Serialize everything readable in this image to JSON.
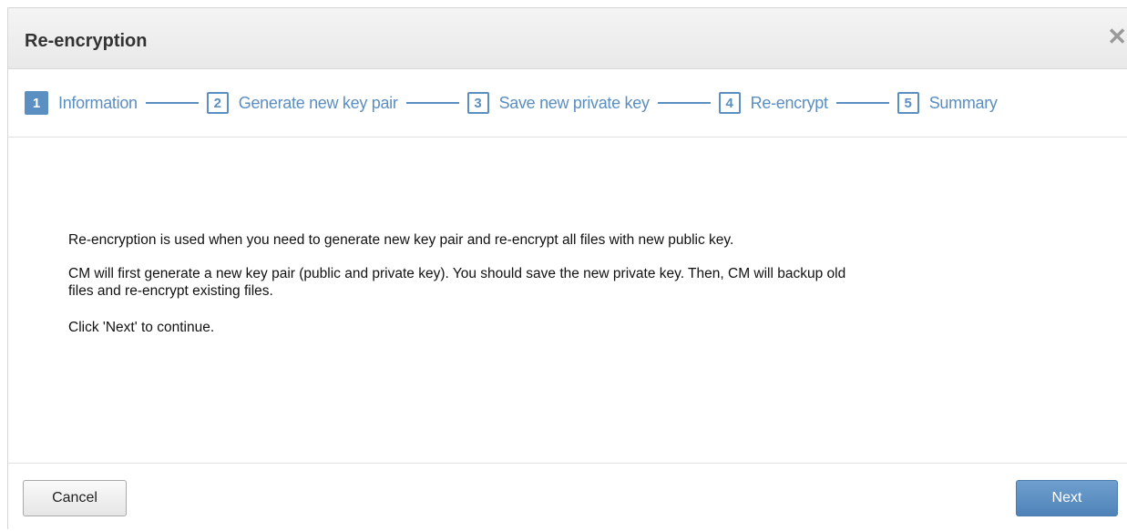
{
  "dialog": {
    "title": "Re-encryption",
    "close_symbol": "✕"
  },
  "steps": [
    {
      "number": "1",
      "label": "Information",
      "active": true
    },
    {
      "number": "2",
      "label": "Generate new key pair",
      "active": false
    },
    {
      "number": "3",
      "label": "Save new private key",
      "active": false
    },
    {
      "number": "4",
      "label": "Re-encrypt",
      "active": false
    },
    {
      "number": "5",
      "label": "Summary",
      "active": false
    }
  ],
  "content": {
    "paragraph1": "Re-encryption is used when you need to generate new key pair and re-encrypt all files with new public key.",
    "paragraph2_line1": "CM will first generate a new key pair (public and private key). You should save the new private key. Then, CM will backup old",
    "paragraph2_line2": "files and re-encrypt existing files.",
    "paragraph3": "Click 'Next' to continue."
  },
  "footer": {
    "cancel_label": "Cancel",
    "next_label": "Next"
  },
  "colors": {
    "accent": "#5b8ec1",
    "title_text": "#333333"
  },
  "icons": {
    "close": "close-icon"
  }
}
